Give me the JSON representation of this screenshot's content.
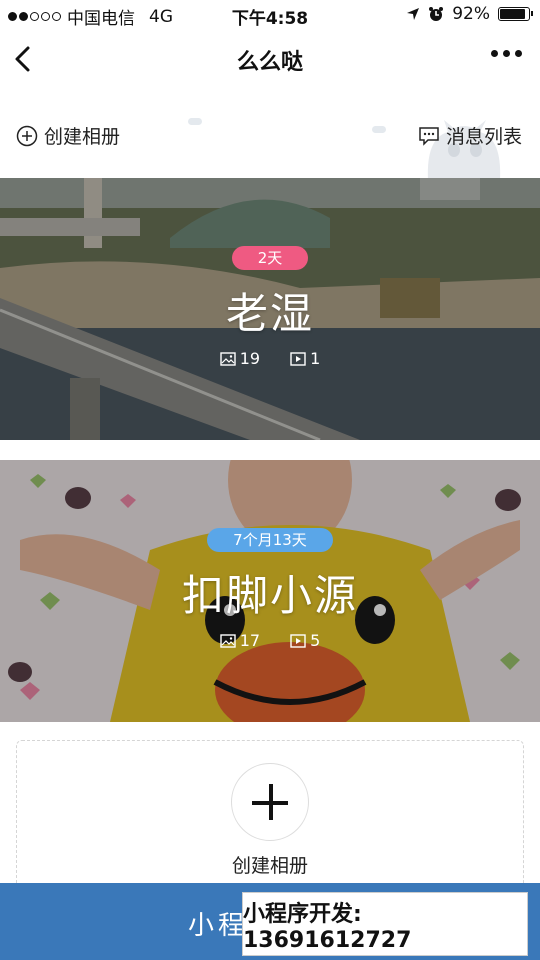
{
  "status_bar": {
    "carrier": "中国电信",
    "network": "4G",
    "time": "下午4:58",
    "battery": "92%"
  },
  "nav": {
    "title": "么么哒"
  },
  "header": {
    "create_album": "创建相册",
    "message_list": "消息列表"
  },
  "albums": [
    {
      "badge": "2天",
      "badge_color": "#ef5a82",
      "name": "老湿",
      "photos": "19",
      "videos": "1"
    },
    {
      "badge": "7个月13天",
      "badge_color": "#5aa6e8",
      "name": "扣脚小源",
      "photos": "17",
      "videos": "5"
    }
  ],
  "create_tile": {
    "label": "创建相册"
  },
  "banner": {
    "text": "小程",
    "ad_text": "小程序开发: 13691612727"
  }
}
